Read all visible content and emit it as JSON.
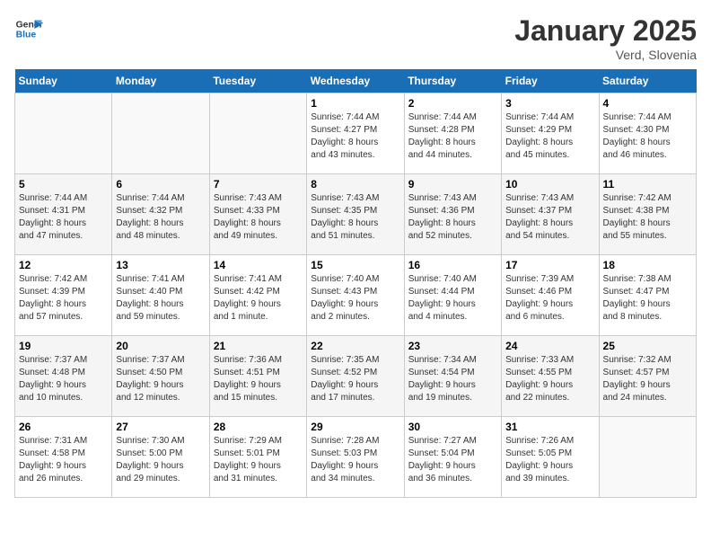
{
  "header": {
    "logo_general": "General",
    "logo_blue": "Blue",
    "month": "January 2025",
    "location": "Verd, Slovenia"
  },
  "days_of_week": [
    "Sunday",
    "Monday",
    "Tuesday",
    "Wednesday",
    "Thursday",
    "Friday",
    "Saturday"
  ],
  "weeks": [
    [
      {
        "day": "",
        "info": ""
      },
      {
        "day": "",
        "info": ""
      },
      {
        "day": "",
        "info": ""
      },
      {
        "day": "1",
        "info": "Sunrise: 7:44 AM\nSunset: 4:27 PM\nDaylight: 8 hours\nand 43 minutes."
      },
      {
        "day": "2",
        "info": "Sunrise: 7:44 AM\nSunset: 4:28 PM\nDaylight: 8 hours\nand 44 minutes."
      },
      {
        "day": "3",
        "info": "Sunrise: 7:44 AM\nSunset: 4:29 PM\nDaylight: 8 hours\nand 45 minutes."
      },
      {
        "day": "4",
        "info": "Sunrise: 7:44 AM\nSunset: 4:30 PM\nDaylight: 8 hours\nand 46 minutes."
      }
    ],
    [
      {
        "day": "5",
        "info": "Sunrise: 7:44 AM\nSunset: 4:31 PM\nDaylight: 8 hours\nand 47 minutes."
      },
      {
        "day": "6",
        "info": "Sunrise: 7:44 AM\nSunset: 4:32 PM\nDaylight: 8 hours\nand 48 minutes."
      },
      {
        "day": "7",
        "info": "Sunrise: 7:43 AM\nSunset: 4:33 PM\nDaylight: 8 hours\nand 49 minutes."
      },
      {
        "day": "8",
        "info": "Sunrise: 7:43 AM\nSunset: 4:35 PM\nDaylight: 8 hours\nand 51 minutes."
      },
      {
        "day": "9",
        "info": "Sunrise: 7:43 AM\nSunset: 4:36 PM\nDaylight: 8 hours\nand 52 minutes."
      },
      {
        "day": "10",
        "info": "Sunrise: 7:43 AM\nSunset: 4:37 PM\nDaylight: 8 hours\nand 54 minutes."
      },
      {
        "day": "11",
        "info": "Sunrise: 7:42 AM\nSunset: 4:38 PM\nDaylight: 8 hours\nand 55 minutes."
      }
    ],
    [
      {
        "day": "12",
        "info": "Sunrise: 7:42 AM\nSunset: 4:39 PM\nDaylight: 8 hours\nand 57 minutes."
      },
      {
        "day": "13",
        "info": "Sunrise: 7:41 AM\nSunset: 4:40 PM\nDaylight: 8 hours\nand 59 minutes."
      },
      {
        "day": "14",
        "info": "Sunrise: 7:41 AM\nSunset: 4:42 PM\nDaylight: 9 hours\nand 1 minute."
      },
      {
        "day": "15",
        "info": "Sunrise: 7:40 AM\nSunset: 4:43 PM\nDaylight: 9 hours\nand 2 minutes."
      },
      {
        "day": "16",
        "info": "Sunrise: 7:40 AM\nSunset: 4:44 PM\nDaylight: 9 hours\nand 4 minutes."
      },
      {
        "day": "17",
        "info": "Sunrise: 7:39 AM\nSunset: 4:46 PM\nDaylight: 9 hours\nand 6 minutes."
      },
      {
        "day": "18",
        "info": "Sunrise: 7:38 AM\nSunset: 4:47 PM\nDaylight: 9 hours\nand 8 minutes."
      }
    ],
    [
      {
        "day": "19",
        "info": "Sunrise: 7:37 AM\nSunset: 4:48 PM\nDaylight: 9 hours\nand 10 minutes."
      },
      {
        "day": "20",
        "info": "Sunrise: 7:37 AM\nSunset: 4:50 PM\nDaylight: 9 hours\nand 12 minutes."
      },
      {
        "day": "21",
        "info": "Sunrise: 7:36 AM\nSunset: 4:51 PM\nDaylight: 9 hours\nand 15 minutes."
      },
      {
        "day": "22",
        "info": "Sunrise: 7:35 AM\nSunset: 4:52 PM\nDaylight: 9 hours\nand 17 minutes."
      },
      {
        "day": "23",
        "info": "Sunrise: 7:34 AM\nSunset: 4:54 PM\nDaylight: 9 hours\nand 19 minutes."
      },
      {
        "day": "24",
        "info": "Sunrise: 7:33 AM\nSunset: 4:55 PM\nDaylight: 9 hours\nand 22 minutes."
      },
      {
        "day": "25",
        "info": "Sunrise: 7:32 AM\nSunset: 4:57 PM\nDaylight: 9 hours\nand 24 minutes."
      }
    ],
    [
      {
        "day": "26",
        "info": "Sunrise: 7:31 AM\nSunset: 4:58 PM\nDaylight: 9 hours\nand 26 minutes."
      },
      {
        "day": "27",
        "info": "Sunrise: 7:30 AM\nSunset: 5:00 PM\nDaylight: 9 hours\nand 29 minutes."
      },
      {
        "day": "28",
        "info": "Sunrise: 7:29 AM\nSunset: 5:01 PM\nDaylight: 9 hours\nand 31 minutes."
      },
      {
        "day": "29",
        "info": "Sunrise: 7:28 AM\nSunset: 5:03 PM\nDaylight: 9 hours\nand 34 minutes."
      },
      {
        "day": "30",
        "info": "Sunrise: 7:27 AM\nSunset: 5:04 PM\nDaylight: 9 hours\nand 36 minutes."
      },
      {
        "day": "31",
        "info": "Sunrise: 7:26 AM\nSunset: 5:05 PM\nDaylight: 9 hours\nand 39 minutes."
      },
      {
        "day": "",
        "info": ""
      }
    ]
  ]
}
